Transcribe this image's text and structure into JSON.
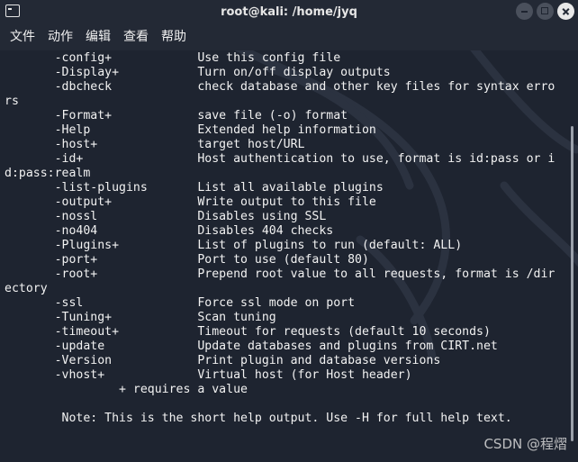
{
  "window": {
    "title": "root@kali: /home/jyq"
  },
  "menu": {
    "items": [
      "文件",
      "动作",
      "编辑",
      "查看",
      "帮助"
    ]
  },
  "terminal": {
    "lines": [
      "       -config+            Use this config file",
      "       -Display+           Turn on/off display outputs",
      "       -dbcheck            check database and other key files for syntax erro",
      "rs",
      "       -Format+            save file (-o) format",
      "       -Help               Extended help information",
      "       -host+              target host/URL",
      "       -id+                Host authentication to use, format is id:pass or i",
      "d:pass:realm",
      "       -list-plugins       List all available plugins",
      "       -output+            Write output to this file",
      "       -nossl              Disables using SSL",
      "       -no404              Disables 404 checks",
      "       -Plugins+           List of plugins to run (default: ALL)",
      "       -port+              Port to use (default 80)",
      "       -root+              Prepend root value to all requests, format is /dir",
      "ectory",
      "       -ssl                Force ssl mode on port",
      "       -Tuning+            Scan tuning",
      "       -timeout+           Timeout for requests (default 10 seconds)",
      "       -update             Update databases and plugins from CIRT.net",
      "       -Version            Print plugin and database versions",
      "       -vhost+             Virtual host (for Host header)",
      "                + requires a value",
      "",
      "        Note: This is the short help output. Use -H for full help text.",
      ""
    ]
  },
  "watermark": "CSDN @程熠",
  "icons": {
    "app": "terminal-icon",
    "minimize": "minimize-icon",
    "maximize": "maximize-icon",
    "close": "close-icon"
  }
}
